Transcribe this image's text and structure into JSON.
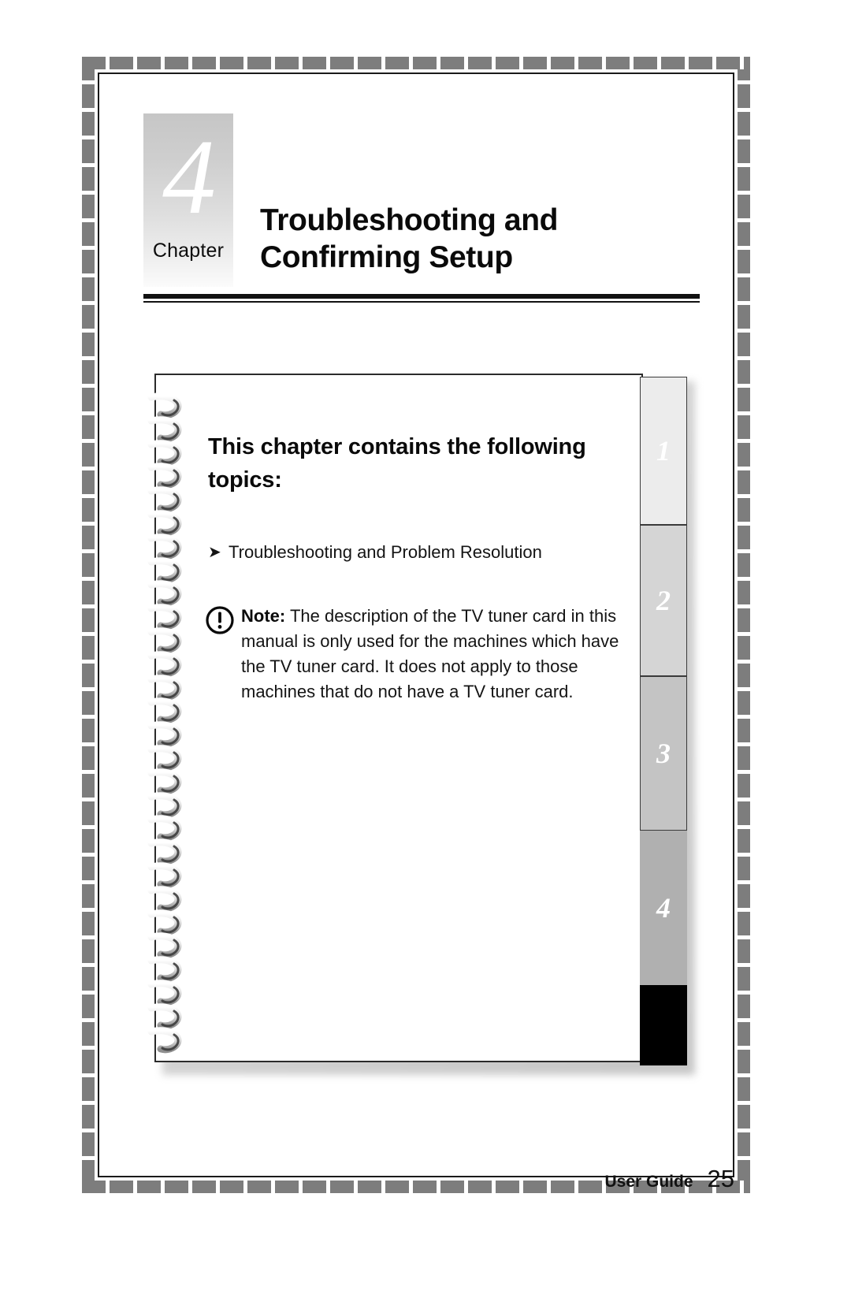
{
  "page": {
    "chapter_label": "Chapter",
    "chapter_number": "4",
    "title": "Troubleshooting and Confirming Setup"
  },
  "notebook": {
    "contents_heading": "This chapter contains the following topics:",
    "topics": [
      {
        "arrow": "➤",
        "label": "Troubleshooting and Problem Resolution"
      }
    ],
    "note": {
      "icon": "warning-exclamation-icon",
      "label": "Note:",
      "text": "The description of the TV tuner card in this manual is only used for the machines which have the TV tuner card. It does not apply to those machines that do not have a TV tuner card."
    },
    "tabs": [
      {
        "label": "1",
        "color": "#ececec"
      },
      {
        "label": "2",
        "color": "#d5d5d5"
      },
      {
        "label": "3",
        "color": "#c4c4c4"
      },
      {
        "label": "4",
        "color": "#b0b0b0"
      },
      {
        "label": "",
        "color": "#000000"
      }
    ]
  },
  "footer": {
    "label": "User Guide",
    "page_number": "25"
  },
  "colors": {
    "frame_dash": "#7d7d7d",
    "rule": "#111111",
    "badge_top": "#c6c6c6",
    "badge_bottom": "#fbfbfb"
  }
}
